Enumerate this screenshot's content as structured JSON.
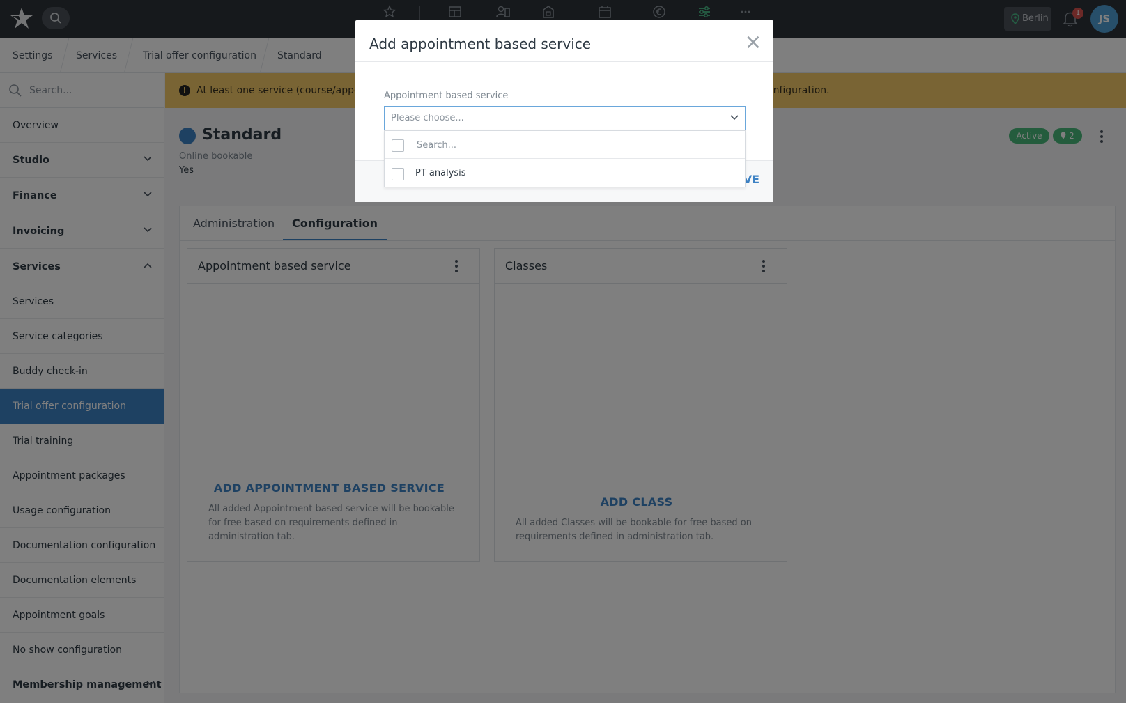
{
  "topbar": {
    "location": "Berlin",
    "notification_count": "1",
    "avatar_initials": "JS"
  },
  "breadcrumb": [
    "Settings",
    "Services",
    "Trial offer configuration",
    "Standard"
  ],
  "sidebar": {
    "search_placeholder": "Search...",
    "items": [
      {
        "label": "Overview"
      },
      {
        "label": "Studio"
      },
      {
        "label": "Finance"
      },
      {
        "label": "Invoicing"
      },
      {
        "label": "Services"
      },
      {
        "label": "Services"
      },
      {
        "label": "Service categories"
      },
      {
        "label": "Buddy check-in"
      },
      {
        "label": "Trial offer configuration"
      },
      {
        "label": "Trial training"
      },
      {
        "label": "Appointment packages"
      },
      {
        "label": "Usage configuration"
      },
      {
        "label": "Documentation configuration"
      },
      {
        "label": "Documentation elements"
      },
      {
        "label": "Appointment goals"
      },
      {
        "label": "No show configuration"
      },
      {
        "label": "Membership management"
      }
    ]
  },
  "alert": {
    "text_start": "At least one service (course/appoint",
    "text_end": "onfiguration."
  },
  "page": {
    "title": "Standard",
    "meta_label": "Online bookable",
    "meta_value": "Yes",
    "status_badge": "Active",
    "location_count": "2"
  },
  "tabs": [
    "Administration",
    "Configuration"
  ],
  "panels": {
    "appointment": {
      "title": "Appointment based service",
      "action": "ADD APPOINTMENT BASED SERVICE",
      "description": "All added Appointment based service will be bookable for free based on requirements defined in administration tab."
    },
    "classes": {
      "title": "Classes",
      "action": "ADD CLASS",
      "description": "All added Classes will be bookable for free based on requirements defined in administration tab."
    }
  },
  "modal": {
    "title": "Add appointment based service",
    "close": "×",
    "field_label": "Appointment based service",
    "select_placeholder": "Please choose...",
    "search_placeholder": "Search...",
    "options": [
      "PT analysis"
    ],
    "save_label_visible": "VE"
  },
  "colors": {
    "accent": "#3d82c4",
    "topbar": "#2d3239",
    "alert": "#f3c868",
    "success": "#49b97a",
    "badge_red": "#d9534f"
  }
}
